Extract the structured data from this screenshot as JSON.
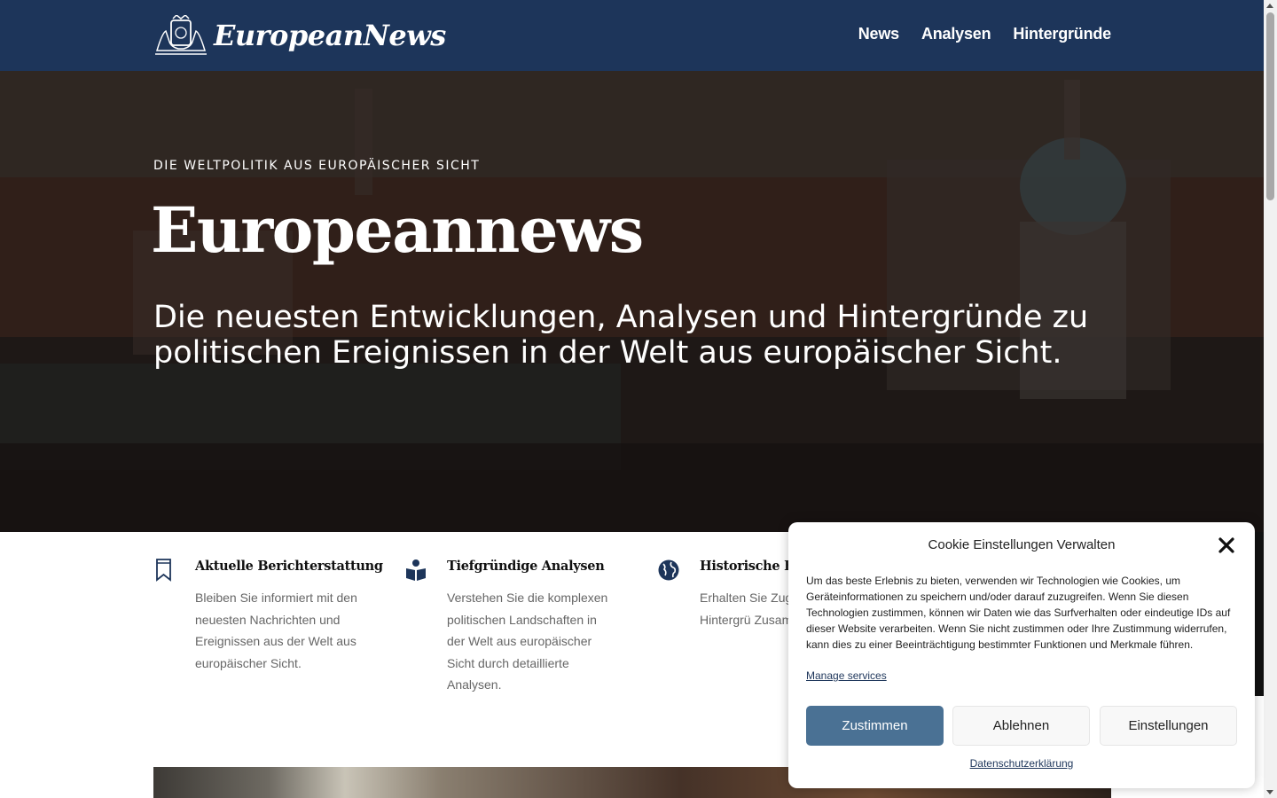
{
  "header": {
    "logo_text": "EuropeanNews",
    "nav": [
      "News",
      "Analysen",
      "Hintergründe"
    ]
  },
  "hero": {
    "eyebrow": "DIE WELTPOLITIK AUS EUROPÄISCHER SICHT",
    "title": "Europeannews",
    "subtitle": "Die neuesten Entwicklungen, Analysen und Hintergründe zu politischen Ereignissen in der Welt aus europäischer Sicht."
  },
  "features": [
    {
      "icon": "bookmark-icon",
      "title": "Aktuelle Berichterstattung",
      "text": "Bleiben Sie informiert mit den neuesten Nachrichten und Ereignissen aus der Welt aus europäischer Sicht."
    },
    {
      "icon": "book-reader-icon",
      "title": "Tiefgründige Analysen",
      "text": "Verstehen Sie die komplexen politischen Landschaften in der Welt aus europäischer Sicht durch detaillierte Analysen."
    },
    {
      "icon": "globe-icon",
      "title": "Historische Hin",
      "text": "Erhalten Sie Zuga henden Hintergrü Zusammenhänge"
    }
  ],
  "cookie": {
    "title": "Cookie Einstellungen Verwalten",
    "text": "Um das beste Erlebnis zu bieten, verwenden wir Technologien wie Cookies, um Geräteinformationen zu speichern und/oder darauf zuzugreifen. Wenn Sie diesen Technologien zustimmen, können wir Daten wie das Surfverhalten oder eindeutige IDs auf dieser Website verarbeiten. Wenn Sie nicht zustimmen oder Ihre Zustimmung widerrufen, kann dies zu einer Beeinträchtigung bestimmter Funktionen und Merkmale führen.",
    "manage_label": "Manage services",
    "accept_label": "Zustimmen",
    "deny_label": "Ablehnen",
    "prefs_label": "Einstellungen",
    "privacy_label": "Datenschutzerklärung"
  },
  "colors": {
    "header_bg": "#1d355a",
    "accept_button": "#4a7194"
  }
}
